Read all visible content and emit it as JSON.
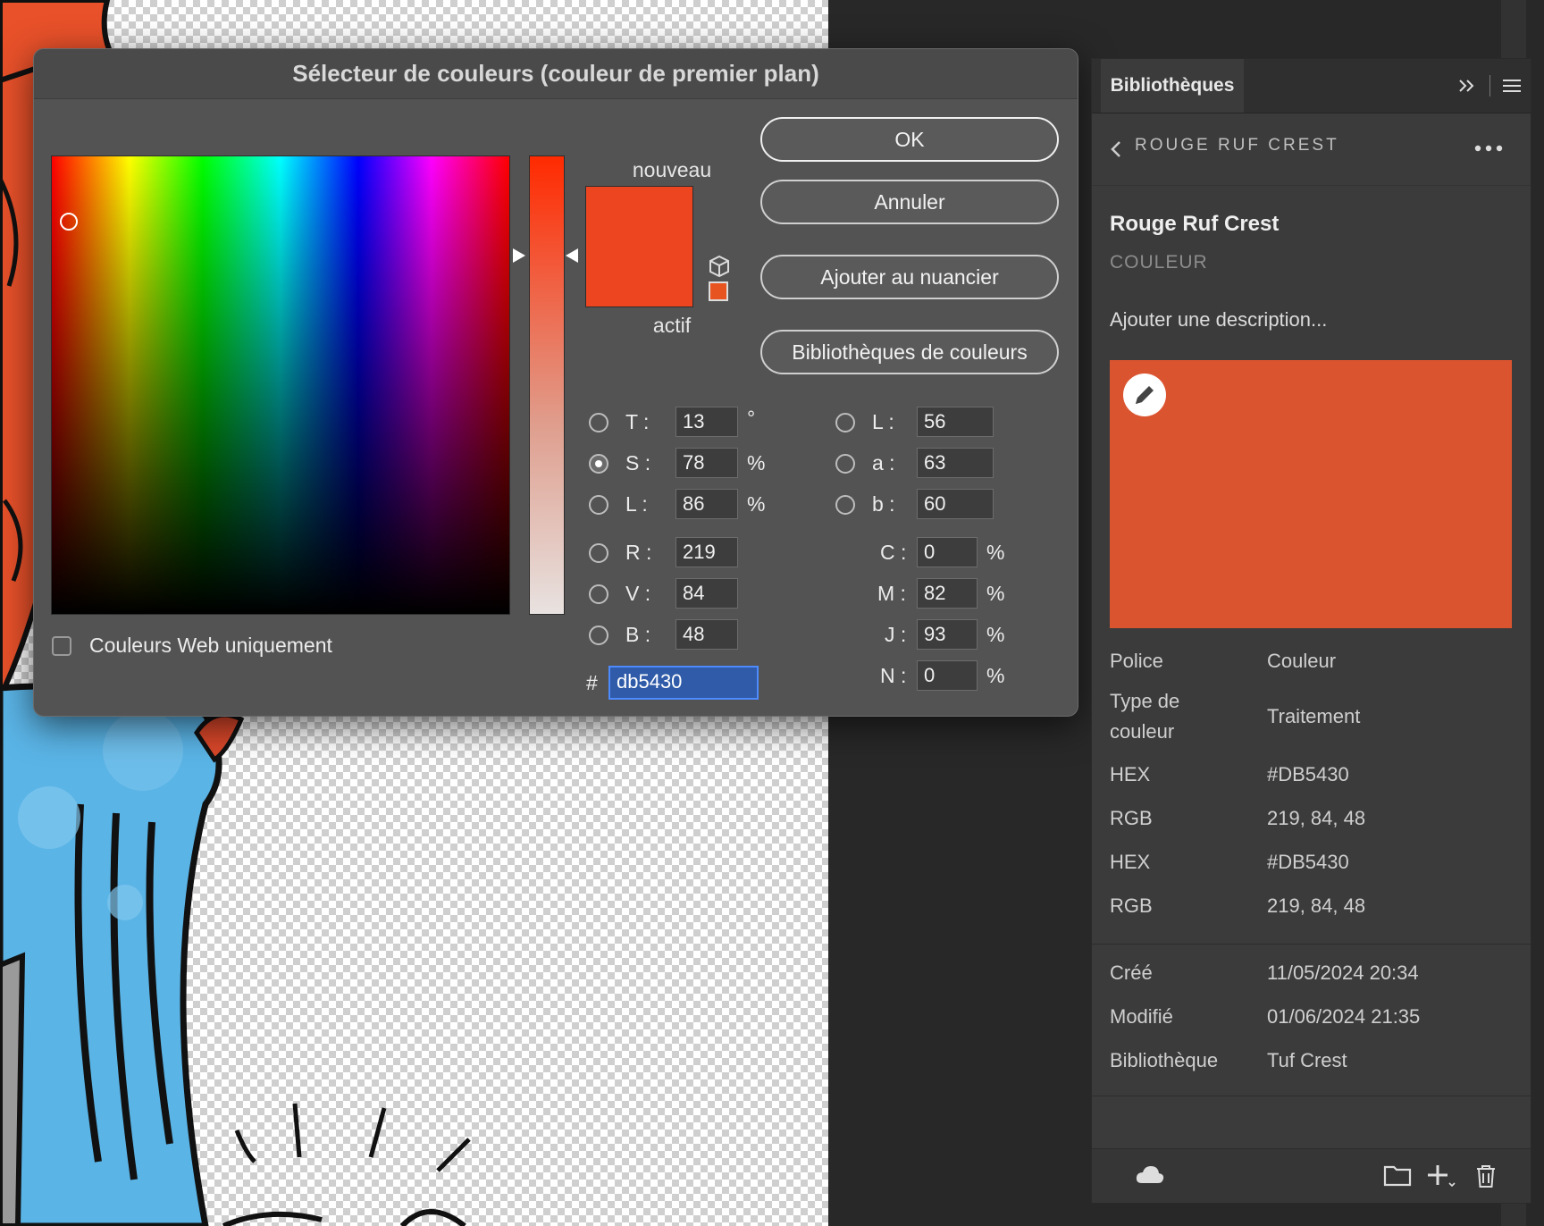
{
  "dialog": {
    "title": "Sélecteur de couleurs (couleur de premier plan)",
    "new_label": "nouveau",
    "current_label": "actif",
    "new_color": "#ee4521",
    "current_color": "#db5430",
    "buttons": {
      "ok": "OK",
      "cancel": "Annuler",
      "add_swatch": "Ajouter au nuancier",
      "color_libraries": "Bibliothèques de couleurs"
    },
    "web_only_label": "Couleurs Web uniquement",
    "hsb": {
      "h_label": "T :",
      "h_value": "13",
      "h_unit": "°",
      "s_label": "S :",
      "s_value": "78",
      "s_unit": "%",
      "b_label": "L :",
      "b_value": "86",
      "b_unit": "%"
    },
    "rgb": {
      "r_label": "R :",
      "r_value": "219",
      "g_label": "V :",
      "g_value": "84",
      "b_label": "B :",
      "b_value": "48"
    },
    "lab": {
      "l_label": "L :",
      "l_value": "56",
      "a_label": "a :",
      "a_value": "63",
      "b_label": "b :",
      "b_value": "60"
    },
    "cmyk": {
      "c_label": "C :",
      "c_value": "0",
      "c_unit": "%",
      "m_label": "M :",
      "m_value": "82",
      "m_unit": "%",
      "y_label": "J :",
      "y_value": "93",
      "y_unit": "%",
      "k_label": "N :",
      "k_value": "0",
      "k_unit": "%"
    },
    "hex_prefix": "#",
    "hex_value": "db5430",
    "selected_mode": "S"
  },
  "libraries": {
    "tab": "Bibliothèques",
    "breadcrumb": "ROUGE RUF CREST",
    "asset_name": "Rouge Ruf Crest",
    "asset_type": "COULEUR",
    "description_placeholder": "Ajouter une description...",
    "swatch_color": "#db5430",
    "props": [
      {
        "key": "Police",
        "value": "Couleur"
      },
      {
        "key": "Type de couleur",
        "value": "Traitement"
      },
      {
        "key": "HEX",
        "value": "#DB5430"
      },
      {
        "key": "RGB",
        "value": "219, 84, 48"
      },
      {
        "key": "HEX",
        "value": "#DB5430"
      },
      {
        "key": "RGB",
        "value": "219, 84, 48"
      }
    ],
    "meta": [
      {
        "key": "Créé",
        "value": "11/05/2024 20:34"
      },
      {
        "key": "Modifié",
        "value": "01/06/2024 21:35"
      },
      {
        "key": "Bibliothèque",
        "value": "Tuf Crest"
      }
    ],
    "type_key_line1": "Type de",
    "type_key_line2": "couleur"
  },
  "icons": [
    "cube-icon",
    "back-icon",
    "more-icon",
    "edit-icon",
    "cloud-icon",
    "folder-icon",
    "add-icon",
    "trash-icon",
    "expand-icon",
    "panel-menu-icon"
  ]
}
